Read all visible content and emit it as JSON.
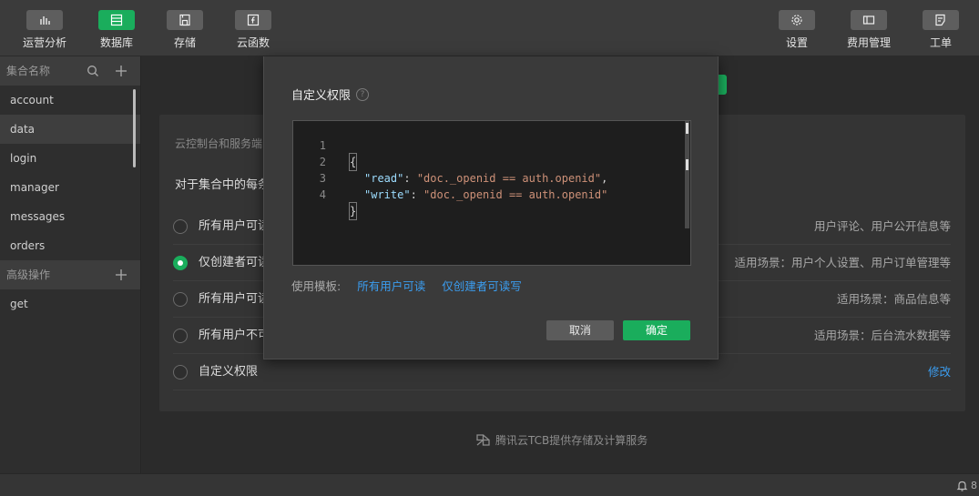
{
  "toolbar": {
    "left": [
      {
        "label": "运营分析",
        "icon": "chart-icon"
      },
      {
        "label": "数据库",
        "icon": "database-icon"
      },
      {
        "label": "存储",
        "icon": "save-icon"
      },
      {
        "label": "云函数",
        "icon": "function-icon"
      }
    ],
    "right": [
      {
        "label": "设置",
        "icon": "gear-icon"
      },
      {
        "label": "费用管理",
        "icon": "billing-icon"
      },
      {
        "label": "工单",
        "icon": "ticket-icon"
      }
    ]
  },
  "sidebar": {
    "collections_header": "集合名称",
    "collections": [
      "account",
      "data",
      "login",
      "manager",
      "messages",
      "orders"
    ],
    "selected": "data",
    "advanced_header": "高级操作",
    "advanced_items": [
      "get"
    ]
  },
  "main": {
    "desc": "云控制台和服务端",
    "intro": "对于集合中的每条",
    "options": [
      {
        "label": "所有用户可读",
        "scene": "用户评论、用户公开信息等"
      },
      {
        "label": "仅创建者可读",
        "scene": "适用场景：用户个人设置、用户订单管理等"
      },
      {
        "label": "所有用户可读",
        "scene": "适用场景：商品信息等"
      },
      {
        "label": "所有用户不可",
        "scene": "适用场景：后台流水数据等"
      },
      {
        "label": "自定义权限",
        "scene": "修改"
      }
    ],
    "footer": "腾讯云TCB提供存储及计算服务"
  },
  "dialog": {
    "title": "自定义权限",
    "help": "?",
    "code": {
      "line_numbers": [
        "1",
        "2",
        "3",
        "4"
      ],
      "open_brace": "{",
      "read_key": "\"read\"",
      "read_value": "\"doc._openid == auth.openid\"",
      "write_key": "\"write\"",
      "write_value": "\"doc._openid == auth.openid\"",
      "close_brace": "}"
    },
    "template_label": "使用模板:",
    "template_links": [
      "所有用户可读",
      "仅创建者可读写"
    ],
    "cancel": "取消",
    "confirm": "确定"
  },
  "status": {
    "notification_count": "8"
  },
  "colors": {
    "accent": "#1aad5c",
    "link": "#3b9df0"
  }
}
